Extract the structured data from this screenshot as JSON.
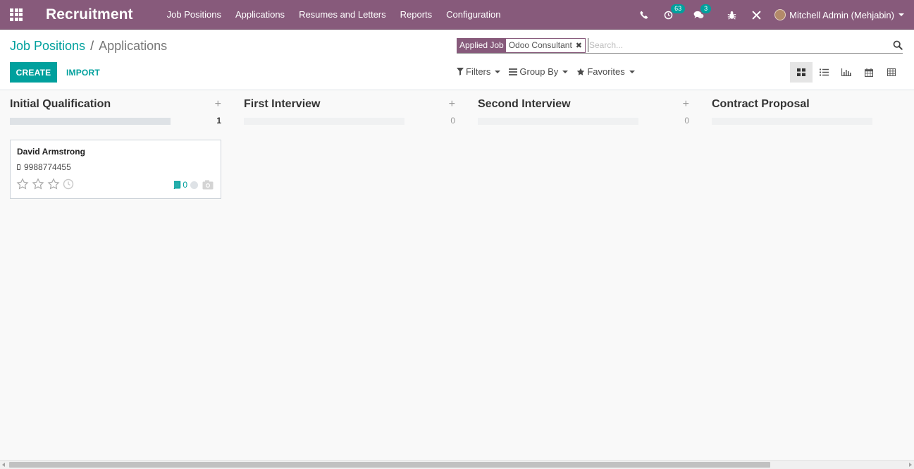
{
  "navbar": {
    "app_name": "Recruitment",
    "menu": [
      "Job Positions",
      "Applications",
      "Resumes and Letters",
      "Reports",
      "Configuration"
    ],
    "activity_count": "63",
    "message_count": "3",
    "user_name": "Mitchell Admin (Mehjabin)"
  },
  "breadcrumb": {
    "parent": "Job Positions",
    "separator": "/",
    "current": "Applications"
  },
  "buttons": {
    "create": "CREATE",
    "import": "IMPORT"
  },
  "search": {
    "facet_label": "Applied Job",
    "facet_value": "Odoo Consultant",
    "remove_glyph": "✖",
    "placeholder": "Search..."
  },
  "filters": {
    "filters": "Filters",
    "group_by": "Group By",
    "favorites": "Favorites"
  },
  "views": [
    "kanban-view-icon",
    "list-view-icon",
    "graph-view-icon",
    "calendar-view-icon",
    "pivot-view-icon"
  ],
  "kanban": {
    "columns": [
      {
        "title": "Initial Qualification",
        "add": "+",
        "count": "1",
        "progress": 1
      },
      {
        "title": "First Interview",
        "add": "+",
        "count": "0",
        "progress": 0
      },
      {
        "title": "Second Interview",
        "add": "+",
        "count": "0",
        "progress": 0
      },
      {
        "title": "Contract Proposal",
        "progress": 0
      }
    ],
    "card": {
      "name": "David Armstrong",
      "phone": "9988774455",
      "stars_filled": 0,
      "stars_total": 3,
      "attachments": "0"
    }
  },
  "colors": {
    "brand": "#875a7b",
    "accent": "#00a09d"
  }
}
